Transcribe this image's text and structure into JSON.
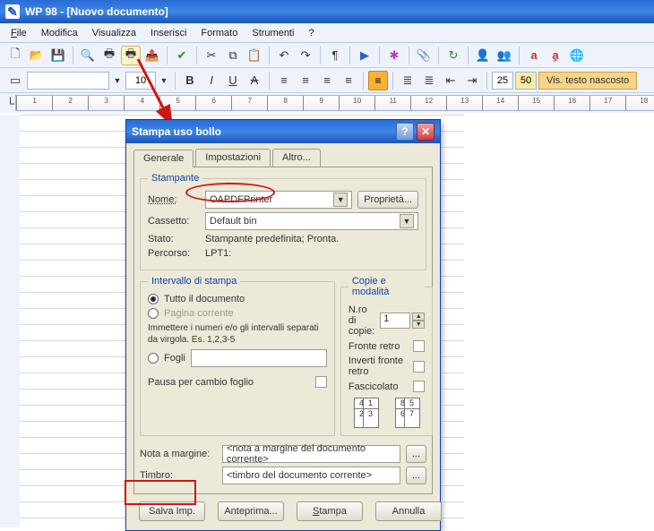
{
  "window": {
    "title": "WP 98 - [Nuovo documento]"
  },
  "menu": {
    "file": "File",
    "modifica": "Modifica",
    "visualizza": "Visualizza",
    "inserisci": "Inserisci",
    "formato": "Formato",
    "strumenti": "Strumenti",
    "help": "?"
  },
  "toolbar2": {
    "font_size": "10",
    "vis_testo": "Vis. testo nascosto",
    "num_box": "25",
    "num_box2": "50"
  },
  "ruler": {
    "ticks": [
      "1",
      "2",
      "3",
      "4",
      "5",
      "6",
      "7",
      "8",
      "9",
      "10",
      "11",
      "12",
      "13",
      "14",
      "15",
      "16",
      "17",
      "18"
    ]
  },
  "dialog": {
    "title": "Stampa uso bollo",
    "tabs": {
      "generale": "Generale",
      "impostazioni": "Impostazioni",
      "altro": "Altro..."
    },
    "stampante": {
      "legend": "Stampante",
      "nome_label": "Nome:",
      "nome_value": "OAPDFPrinter",
      "proprieta": "Proprietà...",
      "cassetto_label": "Cassetto:",
      "cassetto_value": "Default bin",
      "stato_label": "Stato:",
      "stato_value": "Stampante predefinita; Pronta.",
      "percorso_label": "Percorso:",
      "percorso_value": "LPT1:"
    },
    "intervallo": {
      "legend": "Intervallo di stampa",
      "tutto": "Tutto il documento",
      "pagina": "Pagina corrente",
      "hint": "Immettere i numeri e/o gli intervalli separati da virgola. Es. 1,2,3-5",
      "fogli": "Fogli",
      "pausa": "Pausa per cambio foglio"
    },
    "copie": {
      "legend": "Copie e modalità",
      "nro_label": "N.ro di copie:",
      "nro_value": "1",
      "fronte_retro": "Fronte retro",
      "inverti": "Inverti fronte retro",
      "fascicolato": "Fascicolato",
      "pages_a": [
        "4",
        "1",
        "2",
        "3"
      ],
      "pages_b": [
        "8",
        "5",
        "6",
        "7"
      ]
    },
    "nota_label": "Nota a margine:",
    "nota_value": "<nota a margine del documento corrente>",
    "timbro_label": "Timbro:",
    "timbro_value": "<timbro del documento corrente>",
    "buttons": {
      "salva": "Salva Imp.",
      "anteprima": "Anteprima...",
      "stampa": "Stampa",
      "annulla": "Annulla"
    },
    "ellipsis": "..."
  }
}
